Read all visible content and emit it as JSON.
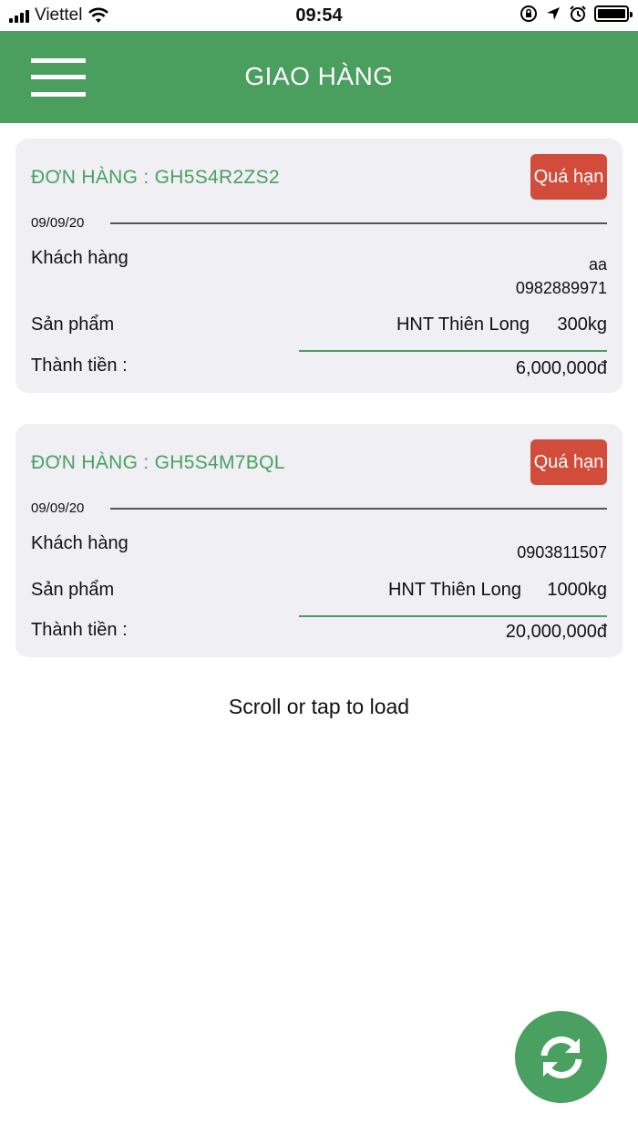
{
  "status_bar": {
    "carrier": "Viettel",
    "time": "09:54"
  },
  "header": {
    "title": "GIAO HÀNG"
  },
  "orders": [
    {
      "order_label": "ĐƠN HÀNG : GH5S4R2ZS2",
      "status": "Quá hạn",
      "date": "09/09/20",
      "customer_label": "Khách hàng",
      "customer_name": "aa",
      "customer_phone": "0982889971",
      "product_label": "Sản phẩm",
      "product_name": "HNT Thiên Long",
      "product_qty": "300kg",
      "total_label": "Thành tiền :",
      "total_value": "6,000,000đ"
    },
    {
      "order_label": "ĐƠN HÀNG : GH5S4M7BQL",
      "status": "Quá hạn",
      "date": "09/09/20",
      "customer_label": "Khách hàng",
      "customer_name": "",
      "customer_phone": "0903811507",
      "product_label": "Sản phẩm",
      "product_name": "HNT Thiên Long",
      "product_qty": "1000kg",
      "total_label": "Thành tiền :",
      "total_value": "20,000,000đ"
    }
  ],
  "load_more": "Scroll or tap to load",
  "icons": {
    "menu": "hamburger-menu-icon",
    "refresh": "refresh-icon"
  },
  "colors": {
    "header": "#4a9e5e",
    "accent_green": "#4aa060",
    "badge_red": "#d24c3c",
    "card_bg": "#efeff4"
  }
}
